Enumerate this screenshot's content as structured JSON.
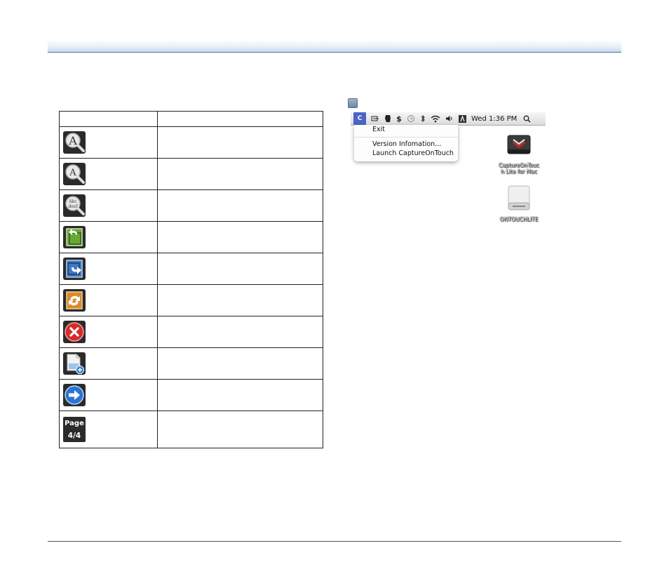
{
  "table": {
    "header": [
      "",
      ""
    ],
    "rows": [
      {
        "icon": "zoom-in-magnifier-icon",
        "description": ""
      },
      {
        "icon": "zoom-out-magnifier-icon",
        "description": ""
      },
      {
        "icon": "fit-page-magnifier-icon",
        "description": ""
      },
      {
        "icon": "rotate-left-icon",
        "description": ""
      },
      {
        "icon": "rotate-right-icon",
        "description": ""
      },
      {
        "icon": "rotate-180-icon",
        "description": ""
      },
      {
        "icon": "delete-icon",
        "description": ""
      },
      {
        "icon": "add-page-icon",
        "description": ""
      },
      {
        "icon": "next-arrow-icon",
        "description": ""
      },
      {
        "icon": "page-counter-icon",
        "description": ""
      }
    ]
  },
  "page_counter": {
    "label": "Page",
    "value": "4/4"
  },
  "zoom_icon_text": {
    "large": "A",
    "fit": "Abc\ndeef"
  },
  "menubar": {
    "app_icon_text": "C",
    "clock": "Wed 1:36 PM"
  },
  "dropdown": {
    "items": [
      "Exit",
      "Version Infomation...",
      "Launch CaptureOnTouch"
    ]
  },
  "desktop": {
    "drive1_label_line1": "CaptureOnTouc",
    "drive1_label_line2": "h Lite for Mac",
    "drive2_label": "ONTOUCHLITE"
  }
}
